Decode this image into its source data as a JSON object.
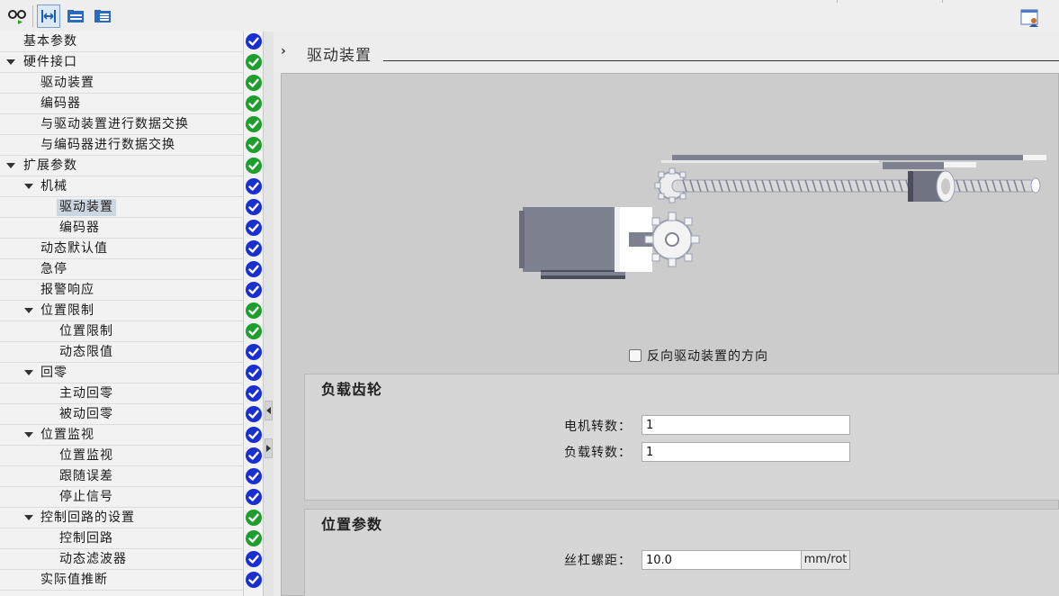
{
  "toolbar": {
    "buttons": [
      {
        "icon": "glasses-icon"
      },
      {
        "icon": "expand-horizontal-icon",
        "active": true
      },
      {
        "icon": "folder-tree-icon"
      },
      {
        "icon": "folder-list-icon"
      }
    ],
    "right_icon": "user-settings-icon"
  },
  "nav": {
    "items": [
      {
        "label": "基本参数",
        "level": 0,
        "expand": false,
        "status": "blue"
      },
      {
        "label": "硬件接口",
        "level": 0,
        "expand": true,
        "status": "green"
      },
      {
        "label": "驱动装置",
        "level": 1,
        "expand": false,
        "status": "green"
      },
      {
        "label": "编码器",
        "level": 1,
        "expand": false,
        "status": "green"
      },
      {
        "label": "与驱动装置进行数据交换",
        "level": 1,
        "expand": false,
        "status": "green"
      },
      {
        "label": "与编码器进行数据交换",
        "level": 1,
        "expand": false,
        "status": "green"
      },
      {
        "label": "扩展参数",
        "level": 0,
        "expand": true,
        "status": "green"
      },
      {
        "label": "机械",
        "level": 1,
        "expand": true,
        "status": "blue"
      },
      {
        "label": "驱动装置",
        "level": 2,
        "expand": false,
        "status": "blue",
        "selected": true
      },
      {
        "label": "编码器",
        "level": 2,
        "expand": false,
        "status": "blue"
      },
      {
        "label": "动态默认值",
        "level": 1,
        "expand": false,
        "status": "blue"
      },
      {
        "label": "急停",
        "level": 1,
        "expand": false,
        "status": "blue"
      },
      {
        "label": "报警响应",
        "level": 1,
        "expand": false,
        "status": "blue"
      },
      {
        "label": "位置限制",
        "level": 1,
        "expand": true,
        "status": "green"
      },
      {
        "label": "位置限制",
        "level": 2,
        "expand": false,
        "status": "green"
      },
      {
        "label": "动态限值",
        "level": 2,
        "expand": false,
        "status": "blue"
      },
      {
        "label": "回零",
        "level": 1,
        "expand": true,
        "status": "blue"
      },
      {
        "label": "主动回零",
        "level": 2,
        "expand": false,
        "status": "blue"
      },
      {
        "label": "被动回零",
        "level": 2,
        "expand": false,
        "status": "blue"
      },
      {
        "label": "位置监视",
        "level": 1,
        "expand": true,
        "status": "blue"
      },
      {
        "label": "位置监视",
        "level": 2,
        "expand": false,
        "status": "blue"
      },
      {
        "label": "跟随误差",
        "level": 2,
        "expand": false,
        "status": "blue"
      },
      {
        "label": "停止信号",
        "level": 2,
        "expand": false,
        "status": "blue"
      },
      {
        "label": "控制回路的设置",
        "level": 1,
        "expand": true,
        "status": "green"
      },
      {
        "label": "控制回路",
        "level": 2,
        "expand": false,
        "status": "green"
      },
      {
        "label": "动态滤波器",
        "level": 2,
        "expand": false,
        "status": "blue"
      },
      {
        "label": "实际值推断",
        "level": 1,
        "expand": false,
        "status": "blue"
      }
    ]
  },
  "colors": {
    "status_green": "#1e9e2c",
    "status_blue": "#1a2fd0"
  },
  "section": {
    "title": "驱动装置"
  },
  "invert_checkbox": {
    "label": "反向驱动装置的方向",
    "checked": false
  },
  "load_gear": {
    "title": "负载齿轮",
    "motor_label": "电机转数：",
    "motor_value": "1",
    "load_label": "负载转数：",
    "load_value": "1"
  },
  "position_params": {
    "title": "位置参数",
    "pitch_label": "丝杠螺距：",
    "pitch_value": "10.0",
    "pitch_unit": "mm/rot"
  }
}
